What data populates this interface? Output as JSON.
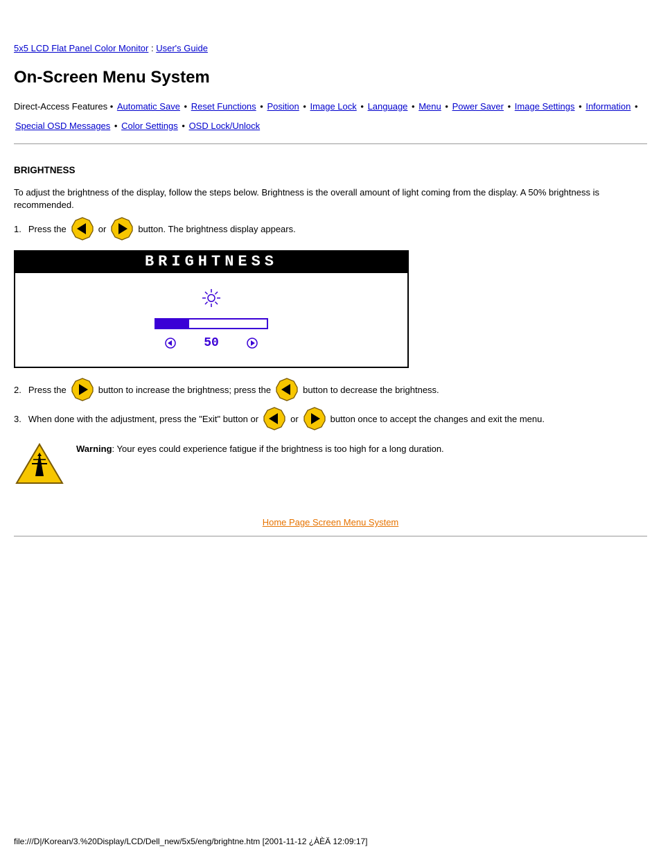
{
  "breadcrumb": {
    "link1": "5x5 LCD Flat Panel Color Monitor",
    "sep": " : ",
    "link2": "User's Guide"
  },
  "heading": "On-Screen Menu System",
  "nav": {
    "prefix": "Direct-Access Features • ",
    "items": [
      "Automatic Save",
      "Reset Functions",
      "Position",
      "Image Lock",
      "Language",
      "Menu",
      "Power Saver",
      "Image Settings",
      "Information",
      "Special OSD Messages",
      "Color Settings",
      "OSD Lock/Unlock"
    ]
  },
  "section_title": "BRIGHTNESS",
  "intro": "To adjust the brightness of the display, follow the steps below. Brightness is the overall amount of light coming from the display. A 50% brightness is recommended.",
  "step1": {
    "num": "1.",
    "pre": "Press the ",
    "or": " or ",
    "post": " button. The brightness display appears."
  },
  "osd": {
    "title": "BRIGHTNESS",
    "value": "50",
    "fill_percent": 30
  },
  "step2": {
    "num": "2.",
    "pre": "Press the ",
    "mid": " button to increase the brightness; press the ",
    "post": " button to decrease the brightness."
  },
  "step3": {
    "num": "3.",
    "pre": "When done with the adjustment, press the \"Exit\" button or ",
    "or": " or ",
    "post": " button once to accept the changes and exit the menu."
  },
  "warning": {
    "label_strong": "Warning",
    "text": ": Your eyes could experience fatigue if the brightness is too high for a long duration."
  },
  "home_link": "Home Page Screen Menu System",
  "file_path": "file:///D|/Korean/3.%20Display/LCD/Dell_new/5x5/eng/brightne.htm [2001-11-12 ¿ÀÈÄ 12:09:17]",
  "page_date": ""
}
